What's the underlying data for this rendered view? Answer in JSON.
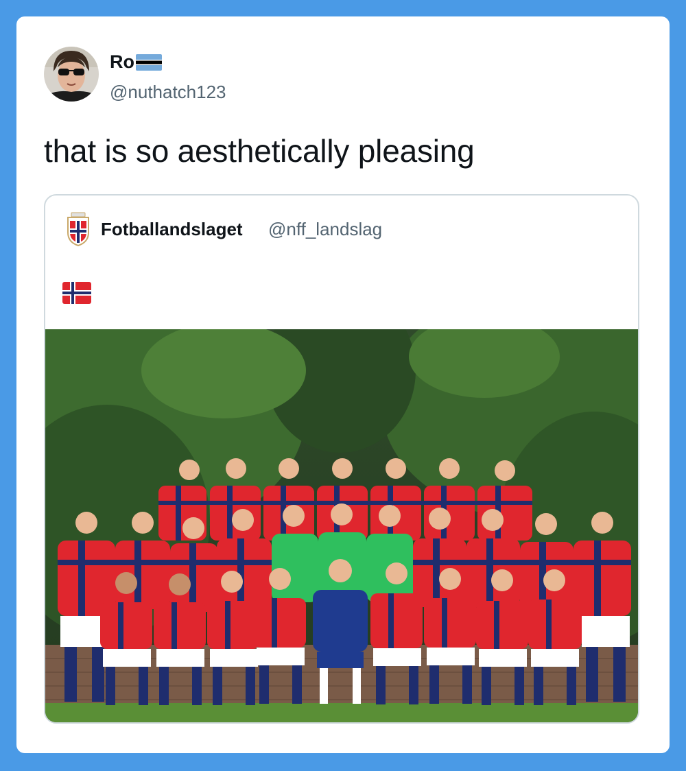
{
  "tweet": {
    "display_name": "Ro",
    "display_name_flag": "flag-botswana-icon",
    "handle": "@nuthatch123",
    "text": "that is so aesthetically pleasing"
  },
  "quoted_tweet": {
    "display_name": "Fotballandslaget",
    "handle": "@nff_landslag",
    "avatar_icon": "norway-football-crest-icon",
    "text_emoji": "flag-norway-icon",
    "photo": "norway-national-team-squad-photo"
  },
  "colors": {
    "background": "#4a9ae6",
    "card": "#ffffff",
    "text_primary": "#0f1419",
    "text_secondary": "#536471",
    "quote_border": "#cfd9de",
    "norway_red": "#e0262e",
    "norway_blue": "#1f2d6e"
  }
}
